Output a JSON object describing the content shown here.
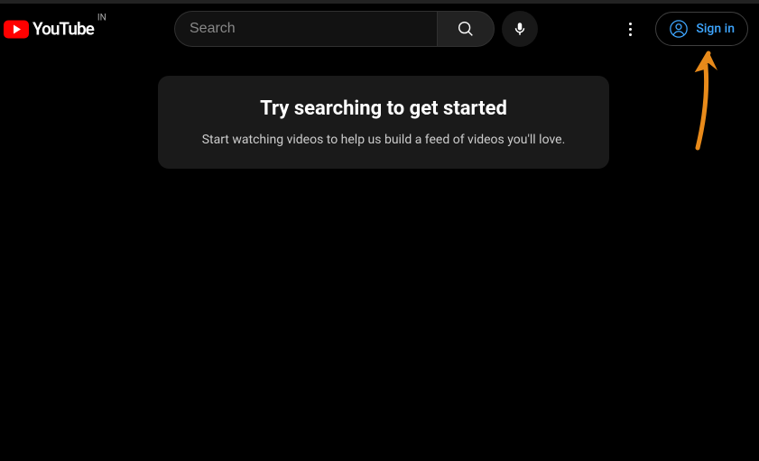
{
  "header": {
    "logo_text": "YouTube",
    "country_code": "IN",
    "search_placeholder": "Search",
    "signin_label": "Sign in"
  },
  "promo": {
    "title": "Try searching to get started",
    "subtitle": "Start watching videos to help us build a feed of videos you'll love."
  }
}
